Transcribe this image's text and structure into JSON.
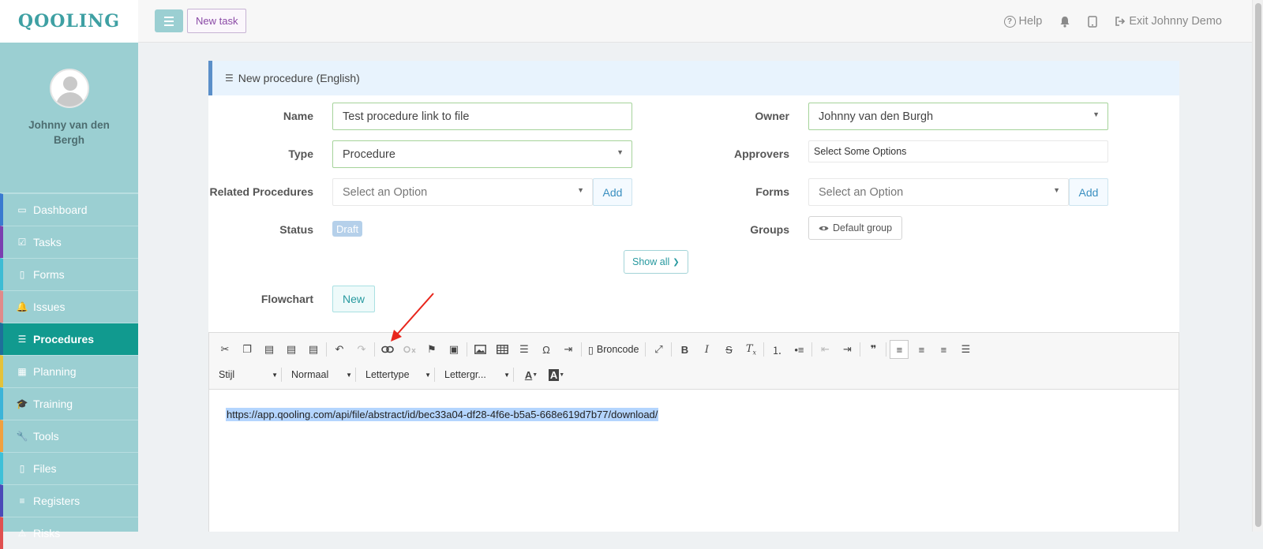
{
  "app": {
    "logo": "QOOLING"
  },
  "sidebar": {
    "user_name": "Johnny van den Bergh",
    "items": [
      {
        "label": "Dashboard",
        "icon": "monitor-icon",
        "glyph": "▭",
        "color": "#3a7ad0"
      },
      {
        "label": "Tasks",
        "icon": "checkbox-icon",
        "glyph": "☑",
        "color": "#7b3fb0"
      },
      {
        "label": "Forms",
        "icon": "document-icon",
        "glyph": "▯",
        "color": "#3dbcd4"
      },
      {
        "label": "Issues",
        "icon": "bell-icon",
        "glyph": "🔔",
        "color": "#e08a8a"
      },
      {
        "label": "Procedures",
        "icon": "list-icon",
        "glyph": "☰",
        "color": "#1e6f9a"
      },
      {
        "label": "Planning",
        "icon": "calendar-icon",
        "glyph": "▦",
        "color": "#e4c23a"
      },
      {
        "label": "Training",
        "icon": "graduation-cap-icon",
        "glyph": "🎓",
        "color": "#3bb4d8"
      },
      {
        "label": "Tools",
        "icon": "wrench-icon",
        "glyph": "🔧",
        "color": "#f0a040"
      },
      {
        "label": "Files",
        "icon": "file-icon",
        "glyph": "▯",
        "color": "#3ec0d8"
      },
      {
        "label": "Registers",
        "icon": "registers-icon",
        "glyph": "≡",
        "color": "#4a4ab8"
      },
      {
        "label": "Risks",
        "icon": "warning-icon",
        "glyph": "⚠",
        "color": "#e05050"
      }
    ]
  },
  "topbar": {
    "new_task_label": "New task",
    "help_label": "Help",
    "exit_label": "Exit Johnny Demo"
  },
  "panel": {
    "title": "New procedure (English)",
    "name_label": "Name",
    "name_value": "Test procedure link to file",
    "type_label": "Type",
    "type_value": "Procedure",
    "related_label": "Related Procedures",
    "related_placeholder": "Select an Option",
    "add_label": "Add",
    "status_label": "Status",
    "status_value": "Draft",
    "owner_label": "Owner",
    "owner_value": "Johnny van den Burgh",
    "approvers_label": "Approvers",
    "approvers_placeholder": "Select Some Options",
    "forms_label": "Forms",
    "forms_placeholder": "Select an Option",
    "groups_label": "Groups",
    "group_value": "Default group",
    "show_all_label": "Show all",
    "flowchart_label": "Flowchart",
    "flowchart_new_label": "New"
  },
  "editor": {
    "source_label": "Broncode",
    "style_label": "Stijl",
    "format_label": "Normaal",
    "font_label": "Lettertype",
    "size_label": "Lettergr...",
    "content": "https://app.qooling.com/api/file/abstract/id/bec33a04-df28-4f6e-b5a5-668e619d7b77/download/"
  },
  "colors": {
    "sidebar_bg": "#9bcfd2",
    "active_nav": "#119a8f",
    "accent": "#27999f"
  }
}
